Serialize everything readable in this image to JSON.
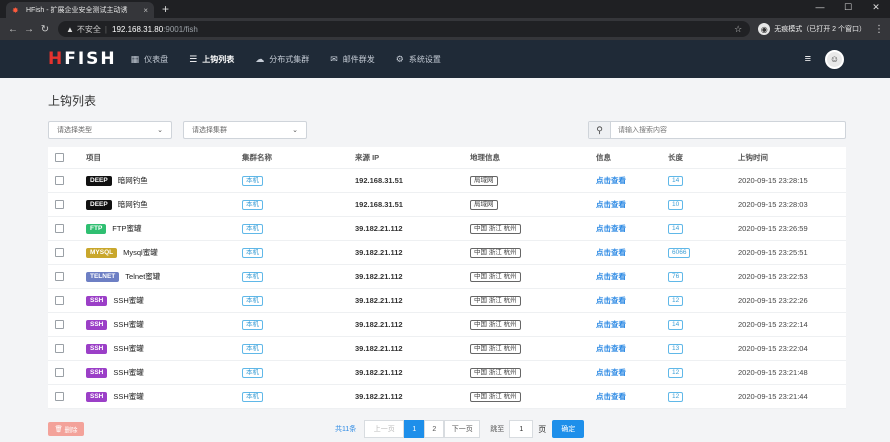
{
  "browser": {
    "tab_title": "HFish - 扩展企业安全测试主动诱",
    "tab_close": "×",
    "new_tab": "+",
    "win_min": "—",
    "win_max": "☐",
    "win_close": "✕",
    "insecure_label": "不安全",
    "url_host": "192.168.31.80",
    "url_path": ":9001/fish",
    "incognito_label": "无痕模式（已打开 2 个窗口）"
  },
  "app": {
    "logo": "FISH",
    "logo_h": "H",
    "nav": [
      {
        "label": "仪表盘",
        "icon": "dashboard-icon"
      },
      {
        "label": "上钩列表",
        "icon": "list-icon"
      },
      {
        "label": "分布式集群",
        "icon": "cloud-icon"
      },
      {
        "label": "邮件群发",
        "icon": "mail-icon"
      },
      {
        "label": "系统设置",
        "icon": "gear-icon"
      }
    ]
  },
  "page": {
    "title": "上钩列表",
    "filter_type_placeholder": "请选择类型",
    "filter_cluster_placeholder": "请选择集群",
    "search_placeholder": "请输入搜索内容"
  },
  "table": {
    "headers": [
      "项目",
      "集群名称",
      "来源 IP",
      "地理信息",
      "信息",
      "长度",
      "上钩时间"
    ],
    "rows": [
      {
        "badge": "DEEP",
        "badge_color": "#111111",
        "name": "暗网钓鱼",
        "cluster": "本机",
        "ip": "192.168.31.51",
        "geo": "局域网",
        "info": "点击查看",
        "length": "14",
        "time": "2020-09-15 23:28:15"
      },
      {
        "badge": "DEEP",
        "badge_color": "#111111",
        "name": "暗网钓鱼",
        "cluster": "本机",
        "ip": "192.168.31.51",
        "geo": "局域网",
        "info": "点击查看",
        "length": "10",
        "time": "2020-09-15 23:28:03"
      },
      {
        "badge": "FTP",
        "badge_color": "#2fbf71",
        "name": "FTP蜜罐",
        "cluster": "本机",
        "ip": "39.182.21.112",
        "geo": "中国 浙江 杭州",
        "info": "点击查看",
        "length": "14",
        "time": "2020-09-15 23:26:59"
      },
      {
        "badge": "MYSQL",
        "badge_color": "#c9a72c",
        "name": "Mysql蜜罐",
        "cluster": "本机",
        "ip": "39.182.21.112",
        "geo": "中国 浙江 杭州",
        "info": "点击查看",
        "length": "6066",
        "time": "2020-09-15 23:25:51"
      },
      {
        "badge": "TELNET",
        "badge_color": "#6d7fc4",
        "name": "Telnet蜜罐",
        "cluster": "本机",
        "ip": "39.182.21.112",
        "geo": "中国 浙江 杭州",
        "info": "点击查看",
        "length": "76",
        "time": "2020-09-15 23:22:53"
      },
      {
        "badge": "SSH",
        "badge_color": "#9b3fc7",
        "name": "SSH蜜罐",
        "cluster": "本机",
        "ip": "39.182.21.112",
        "geo": "中国 浙江 杭州",
        "info": "点击查看",
        "length": "12",
        "time": "2020-09-15 23:22:26"
      },
      {
        "badge": "SSH",
        "badge_color": "#9b3fc7",
        "name": "SSH蜜罐",
        "cluster": "本机",
        "ip": "39.182.21.112",
        "geo": "中国 浙江 杭州",
        "info": "点击查看",
        "length": "14",
        "time": "2020-09-15 23:22:14"
      },
      {
        "badge": "SSH",
        "badge_color": "#9b3fc7",
        "name": "SSH蜜罐",
        "cluster": "本机",
        "ip": "39.182.21.112",
        "geo": "中国 浙江 杭州",
        "info": "点击查看",
        "length": "13",
        "time": "2020-09-15 23:22:04"
      },
      {
        "badge": "SSH",
        "badge_color": "#9b3fc7",
        "name": "SSH蜜罐",
        "cluster": "本机",
        "ip": "39.182.21.112",
        "geo": "中国 浙江 杭州",
        "info": "点击查看",
        "length": "12",
        "time": "2020-09-15 23:21:48"
      },
      {
        "badge": "SSH",
        "badge_color": "#9b3fc7",
        "name": "SSH蜜罐",
        "cluster": "本机",
        "ip": "39.182.21.112",
        "geo": "中国 浙江 杭州",
        "info": "点击查看",
        "length": "12",
        "time": "2020-09-15 23:21:44"
      }
    ]
  },
  "footer": {
    "delete_label": "删除",
    "total": "共11条",
    "prev": "上一页",
    "pages": [
      "1",
      "2"
    ],
    "current_page": "1",
    "next": "下一页",
    "jump_to": "跳至",
    "jump_value": "1",
    "page_unit": "页",
    "confirm": "确定"
  }
}
